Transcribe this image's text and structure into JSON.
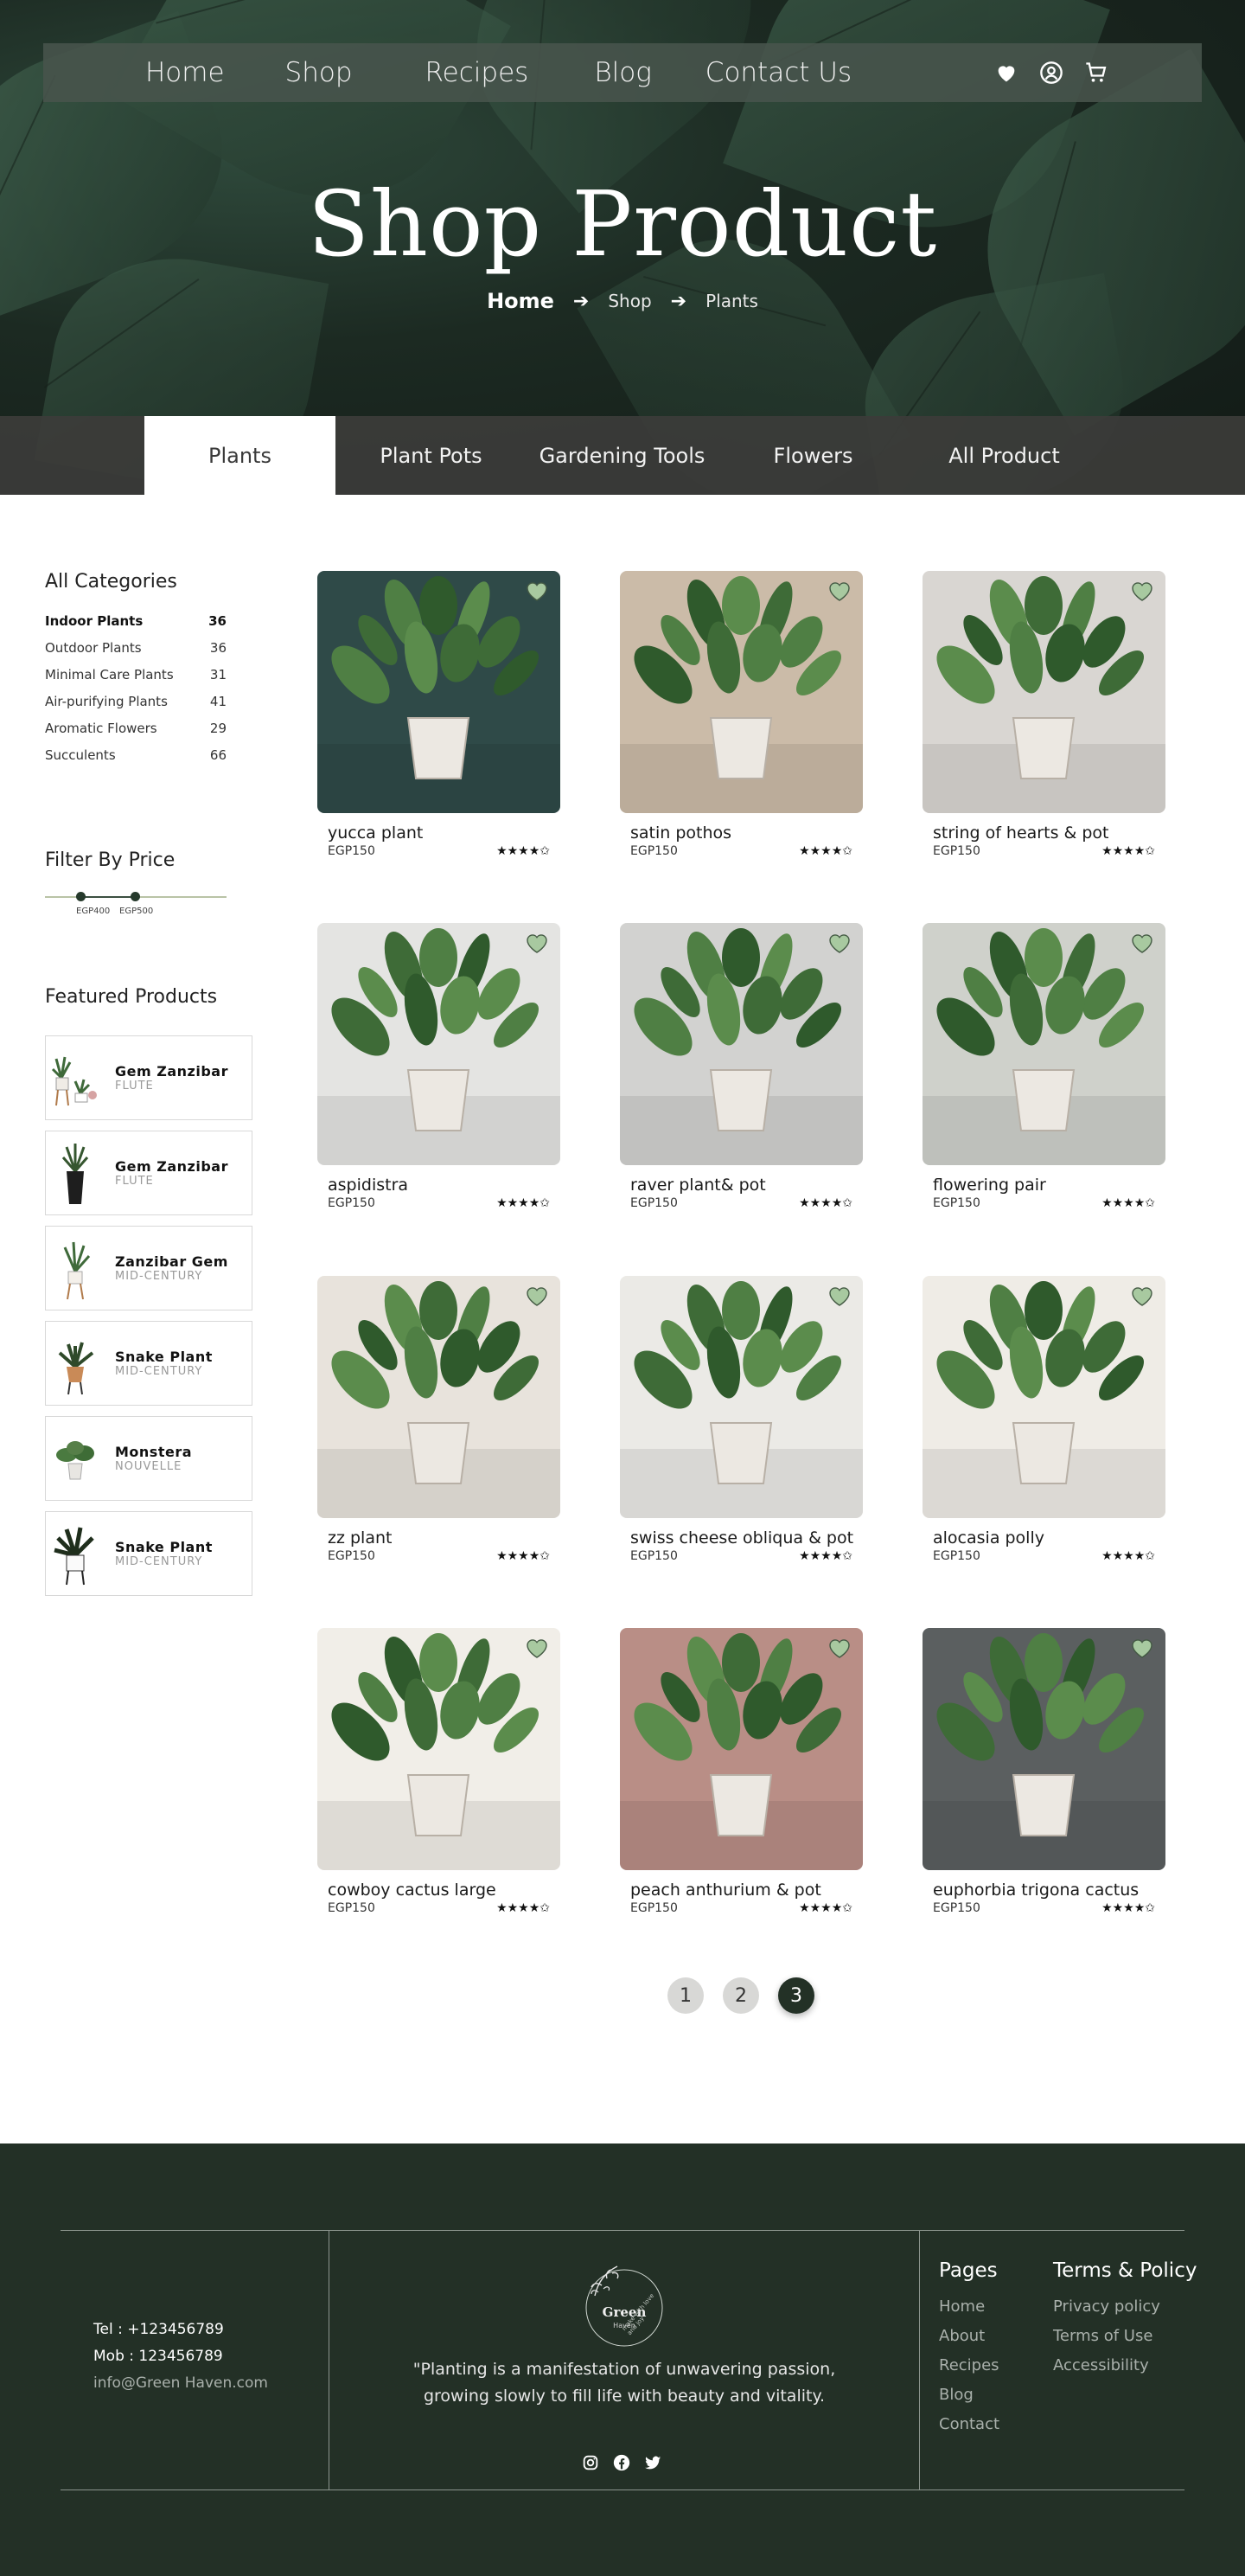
{
  "nav": {
    "links": [
      "Home",
      "Shop",
      "Recipes",
      "Blog",
      "Contact Us"
    ],
    "icons": [
      "heart-icon",
      "user-icon",
      "cart-icon"
    ]
  },
  "hero": {
    "title": "Shop Product",
    "breadcrumb": [
      "Home",
      "Shop",
      "Plants"
    ]
  },
  "tabs": {
    "items": [
      "Plants",
      "Plant Pots",
      "Gardening Tools",
      "Flowers",
      "All Product"
    ],
    "active": "Plants"
  },
  "sidebar": {
    "categories_title": "All Categories",
    "categories": [
      {
        "label": "Indoor Plants",
        "count": "36"
      },
      {
        "label": "Outdoor Plants",
        "count": "36"
      },
      {
        "label": "Minimal Care Plants",
        "count": "31"
      },
      {
        "label": "Air-purifying  Plants",
        "count": "41"
      },
      {
        "label": "Aromatic Flowers",
        "count": "29"
      },
      {
        "label": "Succulents",
        "count": "66"
      }
    ],
    "price_title": "Filter By Price",
    "price_min": "EGP400",
    "price_max": "EGP500",
    "featured_title": "Featured Products",
    "featured": [
      {
        "name": "Gem Zanzibar",
        "sub": "FLUTE"
      },
      {
        "name": "Gem Zanzibar",
        "sub": "FLUTE"
      },
      {
        "name": "Zanzibar Gem",
        "sub": "MID-CENTURY"
      },
      {
        "name": "Snake Plant",
        "sub": "MID-CENTURY"
      },
      {
        "name": "Monstera",
        "sub": "NOUVELLE"
      },
      {
        "name": "Snake Plant",
        "sub": "MID-CENTURY"
      }
    ]
  },
  "products": [
    {
      "name": "yucca plant",
      "price": "EGP150",
      "stars": "★★★★✩",
      "bg": "#2f4a48"
    },
    {
      "name": "satin pothos",
      "price": "EGP150",
      "stars": "★★★★✩",
      "bg": "#cbbba8"
    },
    {
      "name": "string of hearts & pot",
      "price": "EGP150",
      "stars": "★★★★✩",
      "bg": "#d9d6d2"
    },
    {
      "name": "aspidistra",
      "price": "EGP150",
      "stars": "★★★★✩",
      "bg": "#e4e4e2"
    },
    {
      "name": "raver plant& pot",
      "price": "EGP150",
      "stars": "★★★★✩",
      "bg": "#d2d2d0"
    },
    {
      "name": "flowering pair",
      "price": "EGP150",
      "stars": "★★★★✩",
      "bg": "#cfd1cb"
    },
    {
      "name": "zz plant",
      "price": "EGP150",
      "stars": "★★★★✩",
      "bg": "#e8e3dc"
    },
    {
      "name": "swiss cheese obliqua & pot",
      "price": "EGP150",
      "stars": "★★★★✩",
      "bg": "#ebeae6"
    },
    {
      "name": "alocasia polly",
      "price": "EGP150",
      "stars": "★★★★✩",
      "bg": "#efece6"
    },
    {
      "name": "cowboy cactus large",
      "price": "EGP150",
      "stars": "★★★★✩",
      "bg": "#f1eee8"
    },
    {
      "name": "peach anthurium & pot",
      "price": "EGP150",
      "stars": "★★★★✩",
      "bg": "#b98e86"
    },
    {
      "name": "euphorbia trigona cactus",
      "price": "EGP150",
      "stars": "★★★★✩",
      "bg": "#5b5f60"
    }
  ],
  "pagination": {
    "pages": [
      "1",
      "2",
      "3"
    ],
    "active": "3"
  },
  "footer": {
    "tel": "Tel : +123456789",
    "mob": "Mob : 123456789",
    "email": "info@Green Haven.com",
    "logo_text": "Green",
    "logo_sub": "Haven",
    "logo_tagline": "make with love and joy",
    "quote_line1": "\"Planting is a manifestation of unwavering passion,",
    "quote_line2": "growing slowly to fill life with beauty and vitality.",
    "pages_title": "Pages",
    "pages": [
      "Home",
      "About",
      "Recipes",
      "Blog",
      "Contact"
    ],
    "policy_title": "Terms & Policy",
    "policy": [
      "Privacy policy",
      "Terms of Use",
      "Accessibility"
    ],
    "social": [
      "instagram-icon",
      "facebook-icon",
      "twitter-icon"
    ]
  },
  "colors": {
    "primary_dark": "#233026",
    "heart_fill": "#9fc49a",
    "accent_green": "#263a2c"
  }
}
